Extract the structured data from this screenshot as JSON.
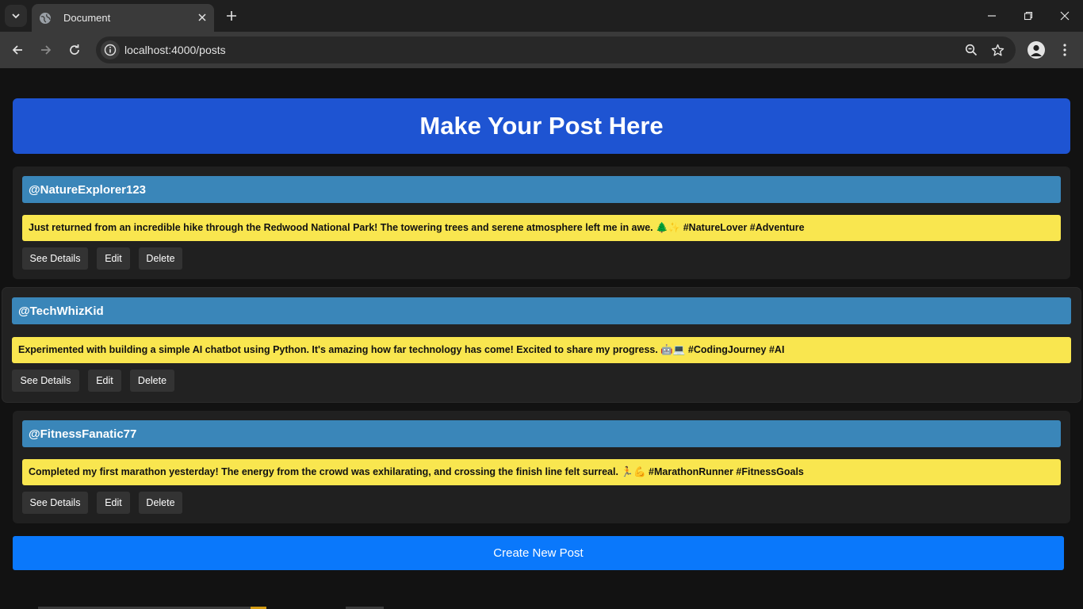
{
  "browser": {
    "tab_title": "Document",
    "url": "localhost:4000/posts"
  },
  "page": {
    "heading": "Make Your Post Here",
    "create_button_label": "Create New Post",
    "actions": {
      "details": "See Details",
      "edit": "Edit",
      "delete": "Delete"
    },
    "posts": [
      {
        "username": "@NatureExplorer123",
        "content": "Just returned from an incredible hike through the Redwood National Park! The towering trees and serene atmosphere left me in awe. 🌲✨ #NatureLover #Adventure"
      },
      {
        "username": "@TechWhizKid",
        "content": "Experimented with building a simple AI chatbot using Python. It's amazing how far technology has come! Excited to share my progress. 🤖💻 #CodingJourney #AI"
      },
      {
        "username": "@FitnessFanatic77",
        "content": "Completed my first marathon yesterday! The energy from the crowd was exhilarating, and crossing the finish line felt surreal. 🏃💪 #MarathonRunner #FitnessGoals"
      }
    ]
  },
  "colors": {
    "banner": "#1e54d2",
    "username_bg": "#3a86b9",
    "content_bg": "#f9e64f",
    "create_button": "#0a78fb"
  }
}
